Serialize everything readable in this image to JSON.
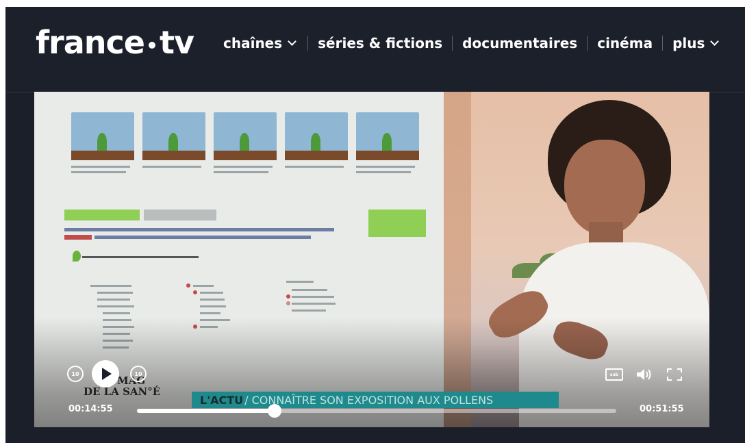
{
  "header": {
    "logo_left": "france",
    "logo_right": "tv",
    "nav": [
      {
        "label": "chaînes",
        "dropdown": true
      },
      {
        "label": "séries & fictions",
        "dropdown": false
      },
      {
        "label": "documentaires",
        "dropdown": false
      },
      {
        "label": "cinéma",
        "dropdown": false
      },
      {
        "label": "plus",
        "dropdown": true
      }
    ]
  },
  "player": {
    "show_logo_line1": "LE MAG",
    "show_logo_line2": "DE LA SAN°É",
    "banner_category": "L'ACTU",
    "banner_text": "/ CONNAÎTRE SON EXPOSITION AUX POLLENS",
    "current_time": "00:14:55",
    "duration": "00:51:55",
    "progress_fraction": 0.2874,
    "skip_back_label": "10",
    "skip_forward_label": "10",
    "subtitles_label": "sub",
    "accent_color": "#1f8a8d"
  },
  "icons": {
    "skip_back": "replay-10-icon",
    "play": "play-icon",
    "skip_forward": "forward-10-icon",
    "subtitles": "subtitles-icon",
    "volume": "volume-icon",
    "fullscreen": "fullscreen-icon"
  }
}
